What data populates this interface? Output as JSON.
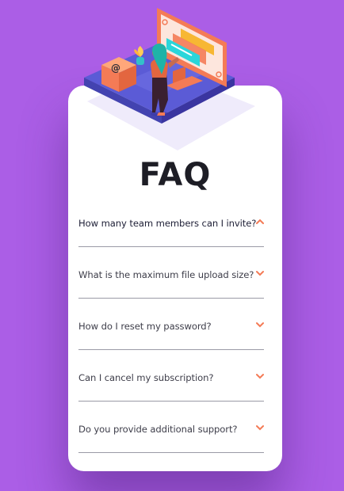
{
  "faq": {
    "title": "FAQ",
    "items": [
      {
        "question": "How many team members can I invite?",
        "expanded": true
      },
      {
        "question": "What is the maximum file upload size?",
        "expanded": false
      },
      {
        "question": "How do I reset my password?",
        "expanded": false
      },
      {
        "question": "Can I cancel my subscription?",
        "expanded": false
      },
      {
        "question": "Do you provide additional support?",
        "expanded": false
      }
    ]
  },
  "colors": {
    "background": "#ab5ee6",
    "card": "#ffffff",
    "accent": "#f47b56",
    "text": "#3e3e4a",
    "divider": "#9a9aa6"
  },
  "icons": {
    "expanded": "chevron-up-icon",
    "collapsed": "chevron-down-icon"
  }
}
